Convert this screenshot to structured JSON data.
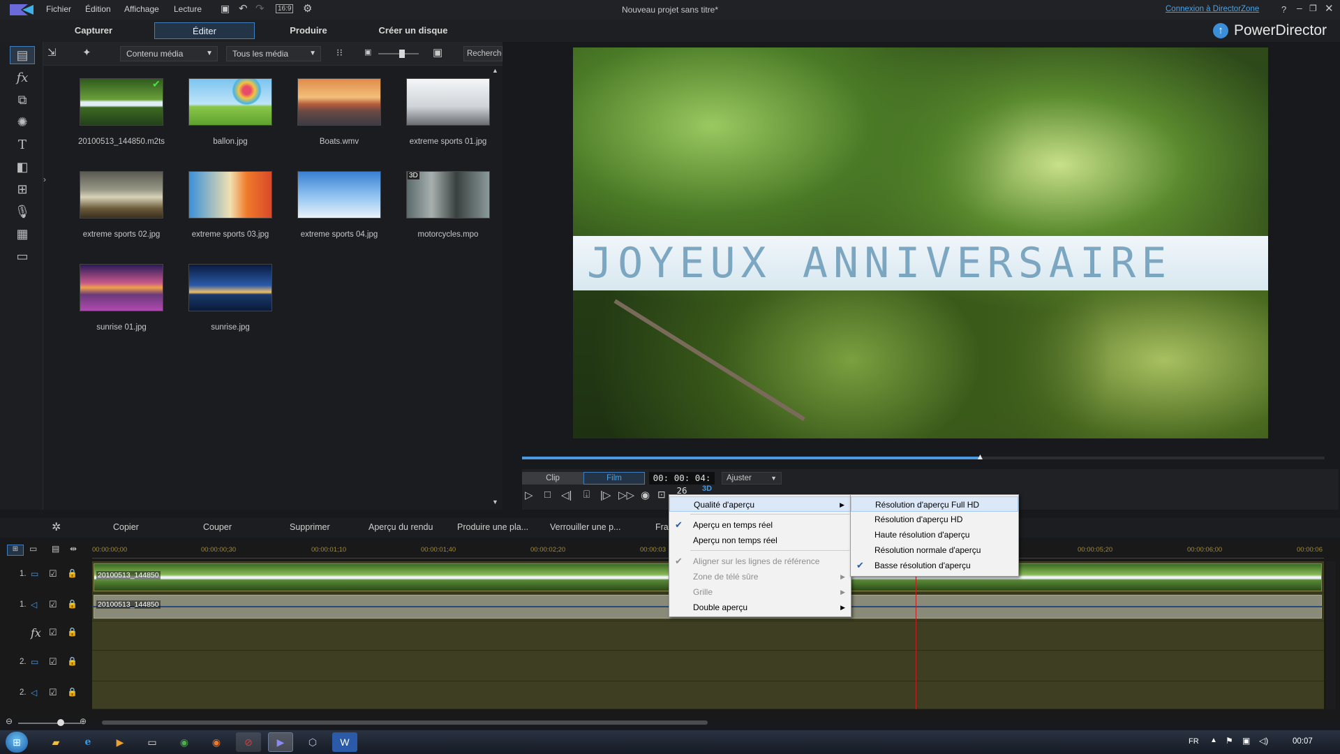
{
  "window": {
    "title": "Nouveau projet sans titre*",
    "login_link": "Connexion à DirectorZone",
    "help": "?",
    "brand": "PowerDirector",
    "ratio": "16:9"
  },
  "menu": [
    "Fichier",
    "Édition",
    "Affichage",
    "Lecture"
  ],
  "tabs": [
    "Capturer",
    "Éditer",
    "Produire",
    "Créer un disque"
  ],
  "library": {
    "filter1": "Contenu média",
    "filter2": "Tous les média",
    "search": "Recherche",
    "items": [
      {
        "name": "20100513_144850.m2ts"
      },
      {
        "name": "ballon.jpg"
      },
      {
        "name": "Boats.wmv"
      },
      {
        "name": "extreme sports 01.jpg"
      },
      {
        "name": "extreme sports 02.jpg"
      },
      {
        "name": "extreme sports 03.jpg"
      },
      {
        "name": "extreme sports 04.jpg"
      },
      {
        "name": "motorcycles.mpo",
        "badge": "3D"
      },
      {
        "name": "sunrise 01.jpg"
      },
      {
        "name": "sunrise.jpg"
      }
    ]
  },
  "preview": {
    "overlay_text": "JOYEUX ANNIVERSAIRE",
    "clip": "Clip",
    "film": "Film",
    "timecode": "00: 00: 04: 26",
    "fit": "Ajuster",
    "progress": 0.57,
    "label_3d": "3D"
  },
  "edit_toolbar": [
    "Copier",
    "Couper",
    "Supprimer",
    "Aperçu du rendu",
    "Produire une pla...",
    "Verrouiller une p...",
    "Fra"
  ],
  "timeline": {
    "ruler": [
      "00:00:00;00",
      "00:00:00;30",
      "00:00:01;10",
      "00:00:01;40",
      "00:00:02;20",
      "00:00:03",
      "00:00:05;20",
      "00:00:06;00",
      "00:00:06"
    ],
    "tracks": [
      {
        "num": "1.",
        "type": "video",
        "clip": "20100513_144850"
      },
      {
        "num": "1.",
        "type": "audio",
        "clip": "20100513_144850"
      },
      {
        "num": "",
        "type": "fx",
        "clip": ""
      },
      {
        "num": "2.",
        "type": "video",
        "clip": ""
      },
      {
        "num": "2.",
        "type": "audio",
        "clip": ""
      }
    ]
  },
  "context_menu": [
    {
      "label": "Qualité d'aperçu",
      "submenu": true,
      "highlight": true
    },
    {
      "label": "Aperçu en temps réel",
      "checked": true
    },
    {
      "label": "Aperçu non temps réel"
    },
    {
      "label": "Aligner sur les lignes de référence",
      "checked": true,
      "disabled": true
    },
    {
      "label": "Zone de télé sûre",
      "submenu": true,
      "disabled": true
    },
    {
      "label": "Grille",
      "submenu": true,
      "disabled": true
    },
    {
      "label": "Double aperçu",
      "submenu": true
    }
  ],
  "quality_submenu": [
    {
      "label": "Résolution d'aperçu Full HD",
      "highlight": true
    },
    {
      "label": "Résolution d'aperçu HD"
    },
    {
      "label": "Haute résolution d'aperçu"
    },
    {
      "label": "Résolution normale d'aperçu"
    },
    {
      "label": "Basse résolution d'aperçu",
      "checked": true
    }
  ],
  "taskbar": {
    "lang": "FR",
    "time": "00:07"
  },
  "colors": {
    "accent": "#3f7fc0",
    "track": "#3e3e22",
    "playhead": "#c02020"
  }
}
